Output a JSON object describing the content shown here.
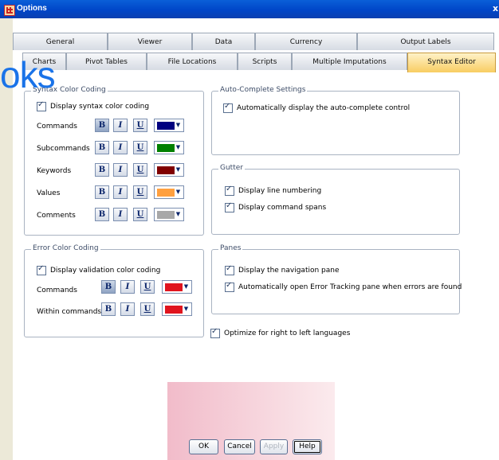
{
  "window": {
    "title": "Options",
    "close": "x"
  },
  "overlay": {
    "watermark_text": "oks"
  },
  "tabs": {
    "row1": [
      "General",
      "Viewer",
      "Data",
      "Currency",
      "Output Labels"
    ],
    "row2": [
      "Charts",
      "Pivot Tables",
      "File Locations",
      "Scripts",
      "Multiple Imputations",
      "Syntax Editor"
    ],
    "active": "Syntax Editor"
  },
  "syntax_color": {
    "title": "Syntax Color Coding",
    "display_label": "Display syntax color coding",
    "rows": [
      {
        "label": "Commands",
        "color": "#000080",
        "bold": true
      },
      {
        "label": "Subcommands",
        "color": "#008000",
        "bold": false
      },
      {
        "label": "Keywords",
        "color": "#800000",
        "bold": false
      },
      {
        "label": "Values",
        "color": "#ffa040",
        "bold": false
      },
      {
        "label": "Comments",
        "color": "#a8a8a8",
        "bold": false
      }
    ]
  },
  "autocomplete": {
    "title": "Auto-Complete Settings",
    "label": "Automatically display the auto-complete control"
  },
  "gutter": {
    "title": "Gutter",
    "items": [
      "Display line numbering",
      "Display command spans"
    ]
  },
  "error_color": {
    "title": "Error Color Coding",
    "display_label": "Display validation color coding",
    "rows": [
      {
        "label": "Commands",
        "color": "#e0141e",
        "bold": true
      },
      {
        "label": "Within commands",
        "color": "#e0141e",
        "bold": false
      }
    ]
  },
  "panes": {
    "title": "Panes",
    "items": [
      "Display the navigation pane",
      "Automatically open Error Tracking pane when errors are found"
    ]
  },
  "rtl": {
    "label": "Optimize for right to left languages"
  },
  "format_buttons": {
    "bold": "B",
    "italic": "I",
    "underline": "U"
  },
  "buttons": {
    "ok": "OK",
    "cancel": "Cancel",
    "apply": "Apply",
    "help": "Help"
  }
}
